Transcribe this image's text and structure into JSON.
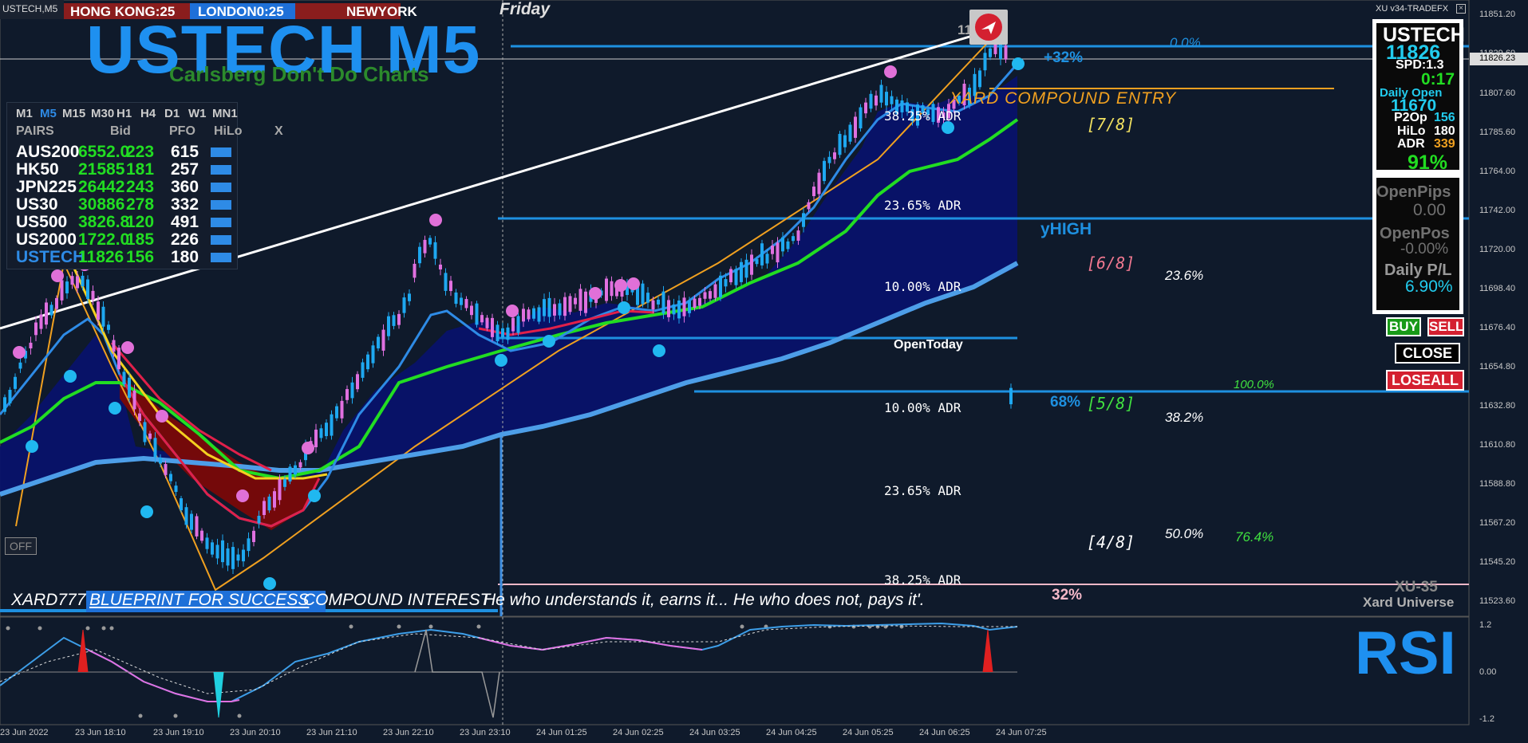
{
  "window": {
    "symbol_tab": "USTECH,M5",
    "day_label": "Friday",
    "indicator_name": "XU v34-TRADEFX"
  },
  "sessions": {
    "hong_kong": "HONG KONG:25",
    "london": "LONDON0:25",
    "newyork": "NEWYORK"
  },
  "title": {
    "main": "USTECH M5",
    "subtitle": "Carlsberg Don't Do Charts"
  },
  "pairs_panel": {
    "timeframes": [
      "M1",
      "M5",
      "M15",
      "M30",
      "H1",
      "H4",
      "D1",
      "W1",
      "MN1"
    ],
    "active_timeframe": "M5",
    "headers": {
      "pairs": "PAIRS",
      "bid": "Bid",
      "pfo": "PFO",
      "hilo": "HiLo",
      "x": "X"
    },
    "rows": [
      {
        "pair": "AUS200",
        "bid": "6552.0",
        "pfo": "223",
        "hilo": "615"
      },
      {
        "pair": "HK50",
        "bid": "21585",
        "pfo": "181",
        "hilo": "257"
      },
      {
        "pair": "JPN225",
        "bid": "26442",
        "pfo": "243",
        "hilo": "360"
      },
      {
        "pair": "US30",
        "bid": "30886",
        "pfo": "278",
        "hilo": "332"
      },
      {
        "pair": "US500",
        "bid": "3826.8",
        "pfo": "120",
        "hilo": "491"
      },
      {
        "pair": "US2000",
        "bid": "1722.0",
        "pfo": "185",
        "hilo": "226"
      },
      {
        "pair": "USTECH",
        "bid": "11826",
        "pfo": "156",
        "hilo": "180"
      }
    ]
  },
  "stats_panel": {
    "symbol": "USTECH",
    "price": "11826",
    "spread": "SPD:1.3",
    "timer": "0:17",
    "daily_open_label": "Daily Open",
    "daily_open": "11670",
    "p2op_label": "P2Op",
    "p2op": "156",
    "hilo_label": "HiLo",
    "hilo": "180",
    "adr_label": "ADR",
    "adr": "339",
    "adr_pct": "91%",
    "open_pips_label": "OpenPips",
    "open_pips": "0.00",
    "open_pos_label": "OpenPos",
    "open_pos": "-0.00%",
    "daily_pl_label": "Daily P/L",
    "daily_pl": "6.90%"
  },
  "trade_buttons": {
    "buy": "BUY",
    "sell": "SELL",
    "close": "CLOSE",
    "close_all": "LOSEALL"
  },
  "off_button": "OFF",
  "chart_labels": {
    "compound_entry": "XARD COMPOUND ENTRY",
    "pct_up": "+32%",
    "yhigh": "yHIGH",
    "open_today": "OpenToday",
    "pct_68": "68%",
    "pct_32": "32%",
    "top_price_label": "11823",
    "adr_levels": [
      "38.25% ADR",
      "23.65% ADR",
      "10.00% ADR",
      "10.00% ADR",
      "23.65% ADR",
      "38.25% ADR"
    ],
    "octaves": [
      "[7/8]",
      "[6/8]",
      "[5/8]",
      "[4/8]"
    ],
    "fibs": [
      "0.0%",
      "23.6%",
      "38.2%",
      "50.0%",
      "76.4%",
      "100.0%"
    ],
    "brand_small": "XU-35",
    "brand": "Xard Universe",
    "ticker_xard": "XARD777",
    "ticker_blueprint": "BLUEPRINT FOR SUCCESS",
    "ticker_compound": "COMPOUND INTEREST",
    "ticker_quote": "He who understands it, earns it... He who does not, pays it'."
  },
  "price_axis": {
    "labels": [
      "11851.20",
      "11829.60",
      "11826.23",
      "11807.60",
      "11785.60",
      "11764.00",
      "11742.00",
      "11720.00",
      "11698.40",
      "11676.40",
      "11654.80",
      "11632.80",
      "11610.80",
      "11588.80",
      "11567.20",
      "11545.20",
      "11523.60"
    ],
    "current": "11826.23"
  },
  "rsi": {
    "label": "RSI",
    "axis": [
      "1.2",
      "0.00",
      "-1.2"
    ]
  },
  "time_axis": [
    "23 Jun 2022",
    "23 Jun 18:10",
    "23 Jun 19:10",
    "23 Jun 20:10",
    "23 Jun 21:10",
    "23 Jun 22:10",
    "23 Jun 23:10",
    "24 Jun 01:25",
    "24 Jun 02:25",
    "24 Jun 03:25",
    "24 Jun 04:25",
    "24 Jun 05:25",
    "24 Jun 06:25",
    "24 Jun 07:25"
  ],
  "colors": {
    "background": "#0f1a2b",
    "bull_candle": "#1ea8f0",
    "bear_candle": "#e070e0",
    "ema_fast": "#2e8be6",
    "ema_mid": "#22dd22",
    "ema_slow": "#4d9ee8",
    "fill_bull": "#0a1878",
    "fill_bear": "#7a0a0a",
    "level_line": "#1e90e0",
    "accent_orange": "#f0a020"
  }
}
